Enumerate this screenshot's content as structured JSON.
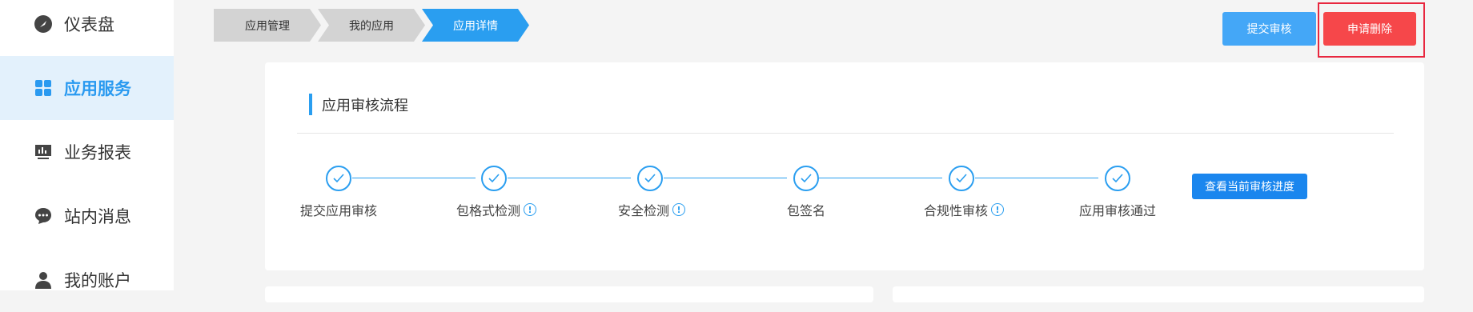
{
  "sidebar": {
    "items": [
      {
        "label": "仪表盘",
        "icon": "dashboard-icon",
        "active": false
      },
      {
        "label": "应用服务",
        "icon": "grid-icon",
        "active": true
      },
      {
        "label": "业务报表",
        "icon": "report-icon",
        "active": false
      },
      {
        "label": "站内消息",
        "icon": "chat-icon",
        "active": false
      },
      {
        "label": "我的账户",
        "icon": "user-icon",
        "active": false
      }
    ]
  },
  "breadcrumb": {
    "items": [
      {
        "label": "应用管理"
      },
      {
        "label": "我的应用"
      },
      {
        "label": "应用详情"
      }
    ]
  },
  "actions": {
    "submit_label": "提交审核",
    "delete_label": "申请删除"
  },
  "review": {
    "title": "应用审核流程",
    "progress_button": "查看当前审核进度",
    "steps": [
      {
        "label": "提交应用审核",
        "has_info": false,
        "done": true
      },
      {
        "label": "包格式检测",
        "has_info": true,
        "done": true
      },
      {
        "label": "安全检测",
        "has_info": true,
        "done": true
      },
      {
        "label": "包签名",
        "has_info": false,
        "done": true
      },
      {
        "label": "合规性审核",
        "has_info": true,
        "done": true
      },
      {
        "label": "应用审核通过",
        "has_info": false,
        "done": true
      }
    ]
  },
  "colors": {
    "accent": "#2a9ef0",
    "danger": "#f6474a",
    "annotation": "#e8273f"
  }
}
